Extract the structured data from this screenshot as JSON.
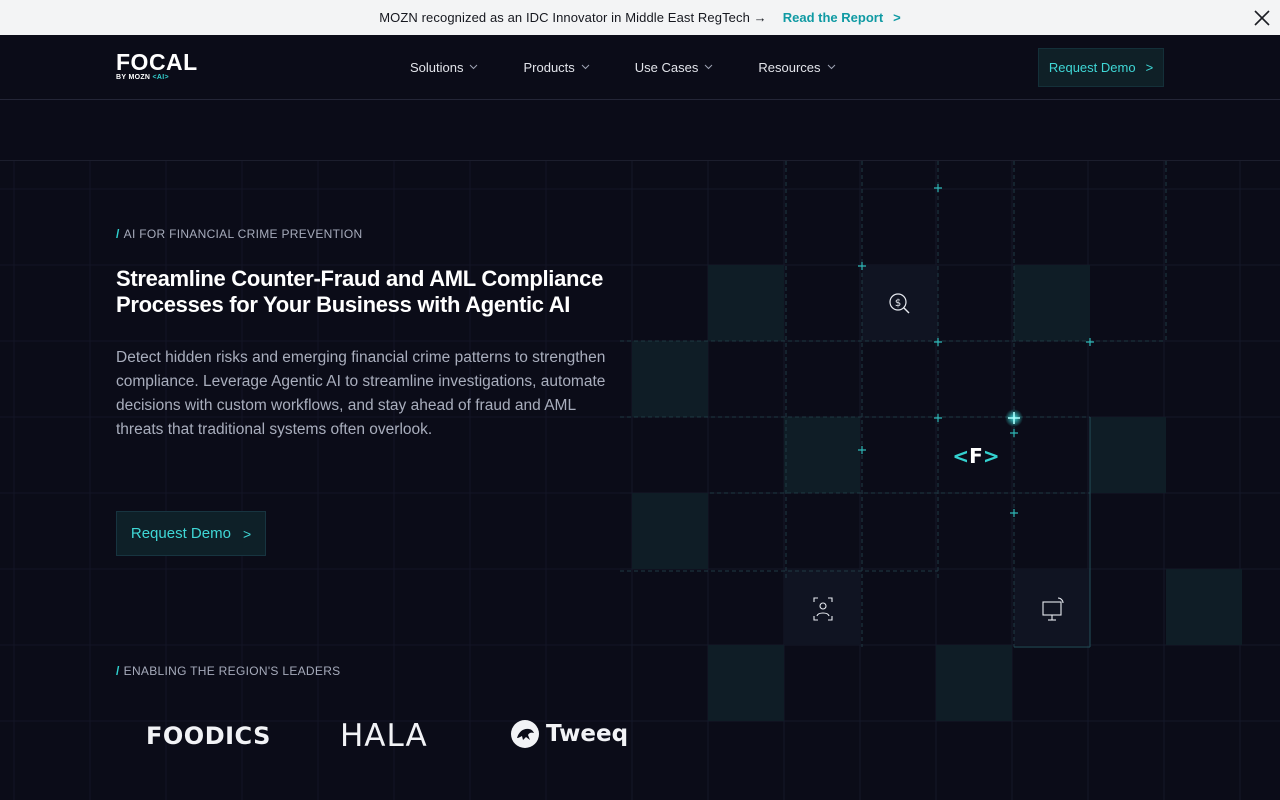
{
  "announcement": {
    "message": "MOZN recognized as an IDC Innovator in Middle East RegTech →",
    "link_label": "Read the Report",
    "link_chevron": ">",
    "close_icon": "close-icon"
  },
  "nav": {
    "logo_word": "FOCAL",
    "logo_sub_by": "BY MOZN",
    "logo_sub_ai": "<AI>",
    "items": [
      {
        "label": "Solutions"
      },
      {
        "label": "Products"
      },
      {
        "label": "Use Cases"
      },
      {
        "label": "Resources"
      }
    ],
    "cta_label": "Request Demo",
    "cta_chevron": ">"
  },
  "hero": {
    "eyebrow": "AI FOR FINANCIAL CRIME PREVENTION",
    "eyebrow_slash": "/",
    "headline": "Streamline Counter-Fraud and AML Compliance Processes for Your Business with Agentic AI",
    "description": "Detect hidden risks and emerging financial crime patterns to strengthen compliance. Leverage Agentic AI to streamline investigations, automate decisions with custom workflows, and stay ahead of fraud and AML threats that traditional systems often overlook.",
    "cta_label": "Request Demo",
    "cta_chevron": ">"
  },
  "leaders": {
    "eyebrow": "ENABLING THE REGION'S LEADERS",
    "eyebrow_slash": "/",
    "logos": [
      {
        "name": "FOODICS"
      },
      {
        "name": "HALA"
      },
      {
        "name": "Tweeq"
      }
    ]
  },
  "illustration": {
    "center_mark": "<F>",
    "icons": [
      "dollar-search-icon",
      "face-scan-icon",
      "monitor-signal-icon"
    ]
  },
  "colors": {
    "accent": "#34d1cf",
    "background": "#0b0c18",
    "announcement_bg": "#f3f4f5"
  }
}
